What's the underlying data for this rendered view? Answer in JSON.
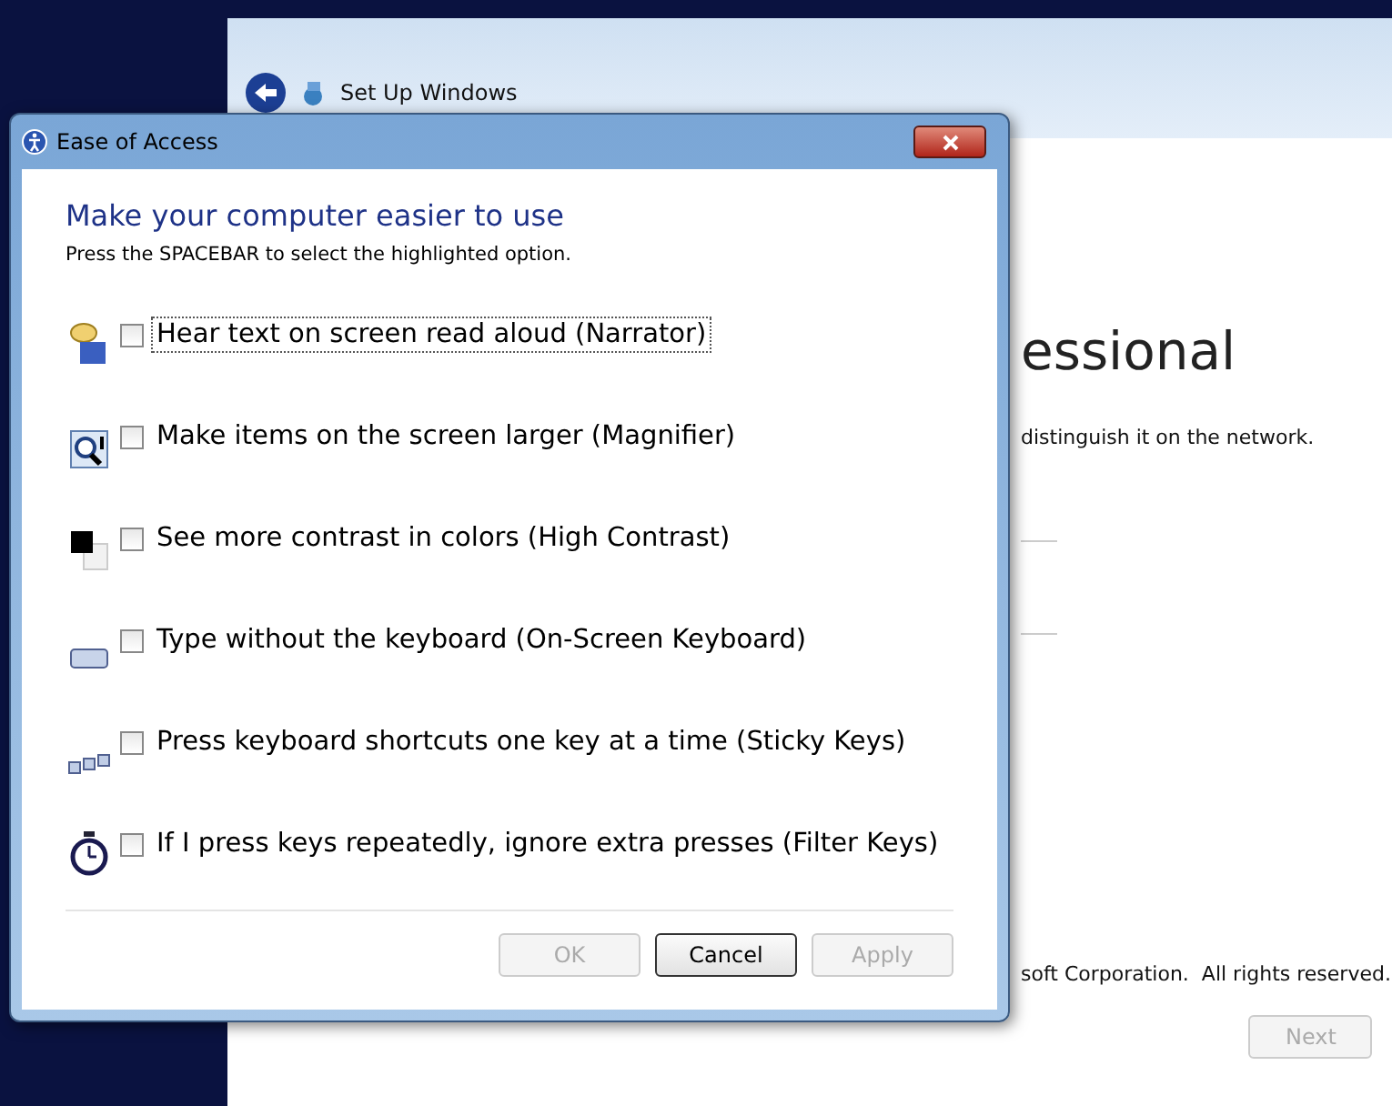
{
  "setup_window": {
    "title": "Set Up Windows",
    "heading": "essional",
    "description": "distinguish it on the network.",
    "copyright": "soft Corporation.  All rights reserved.",
    "next_button": {
      "label": "Next",
      "disabled": true
    }
  },
  "dialog": {
    "title": "Ease of Access",
    "heading": "Make your computer easier to use",
    "instruction": "Press the SPACEBAR to select the highlighted option.",
    "options": [
      {
        "kind": "narrator",
        "label": "Hear text on screen read aloud (Narrator)",
        "checked": false,
        "focused": true
      },
      {
        "kind": "magnifier",
        "label": "Make items on the screen larger (Magnifier)",
        "checked": false,
        "focused": false
      },
      {
        "kind": "contrast",
        "label": "See more contrast in colors (High Contrast)",
        "checked": false,
        "focused": false
      },
      {
        "kind": "keyboard",
        "label": "Type without the keyboard (On-Screen Keyboard)",
        "checked": false,
        "focused": false
      },
      {
        "kind": "sticky",
        "label": "Press keyboard shortcuts one key at a time (Sticky Keys)",
        "checked": false,
        "focused": false
      },
      {
        "kind": "filter",
        "label": "If I press keys repeatedly, ignore extra presses (Filter Keys)",
        "checked": false,
        "focused": false
      }
    ],
    "buttons": [
      {
        "label": "OK",
        "disabled": true,
        "default": false
      },
      {
        "label": "Cancel",
        "disabled": false,
        "default": true
      },
      {
        "label": "Apply",
        "disabled": true,
        "default": false
      }
    ]
  }
}
